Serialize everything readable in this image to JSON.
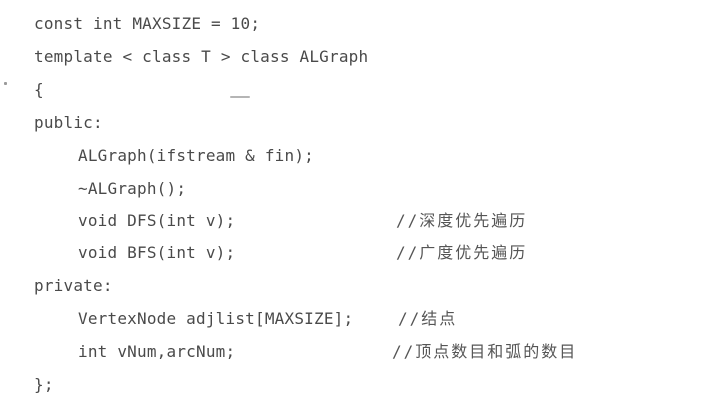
{
  "code": {
    "lines": [
      {
        "text": "const int MAXSIZE = 10;"
      },
      {
        "text": "template < class T > class ALGraph"
      },
      {
        "text": "{"
      },
      {
        "text": "public:"
      },
      {
        "text": "ALGraph(ifstream & fin);"
      },
      {
        "text": "~ALGraph();"
      },
      {
        "text": "void DFS(int v);",
        "comment": "//深度优先遍历"
      },
      {
        "text": "void BFS(int v);",
        "comment": "//广度优先遍历"
      },
      {
        "text": "private:"
      },
      {
        "text": "VertexNode adjlist[MAXSIZE];",
        "comment": "//结点"
      },
      {
        "text": "int vNum,arcNum;",
        "comment": "//顶点数目和弧的数目"
      },
      {
        "text": "};"
      }
    ]
  }
}
